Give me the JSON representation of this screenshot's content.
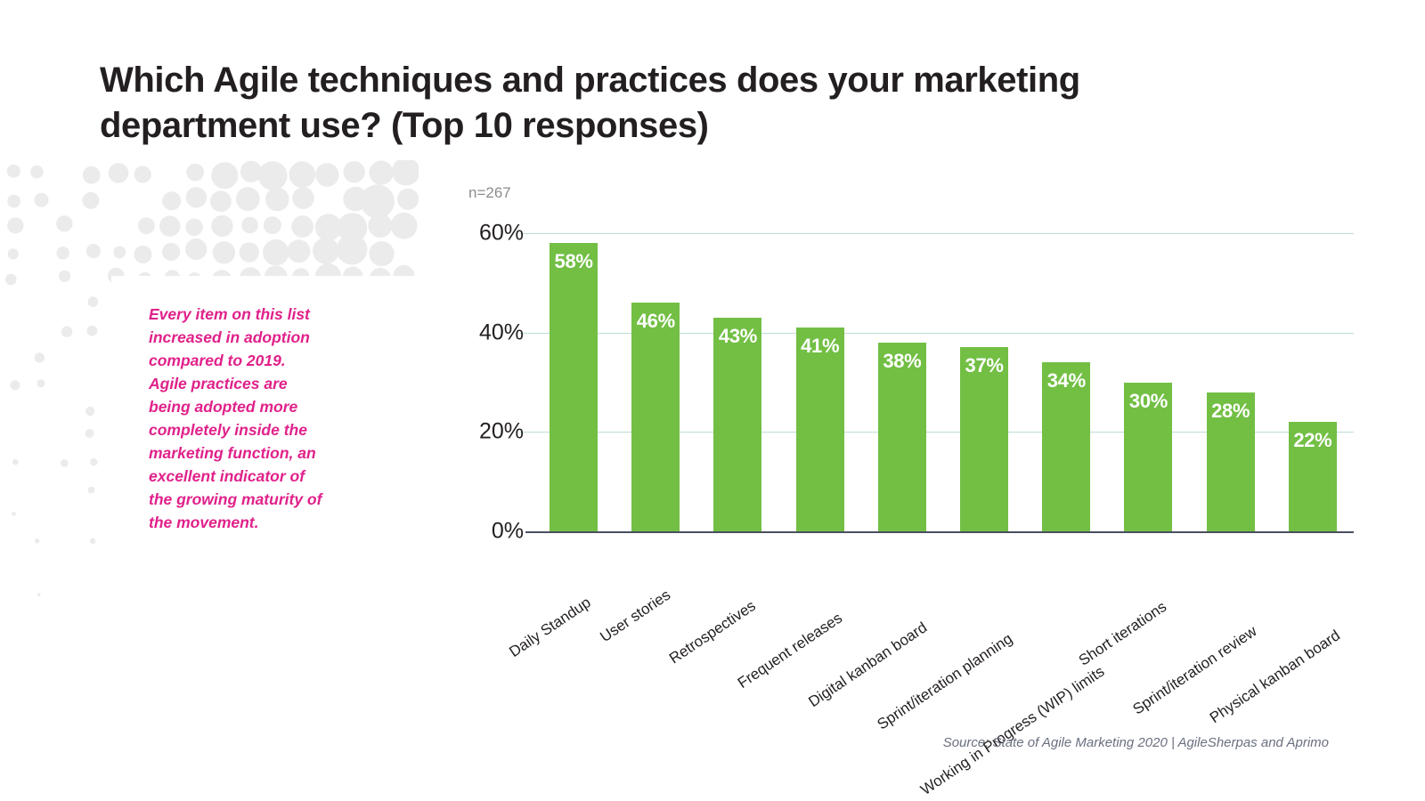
{
  "page_title": "Which Agile techniques and practices does your marketing department use? (Top 10 responses)",
  "callout_text": "Every item on this list increased in adoption compared to 2019. Agile practices are being adopted more completely inside the marketing function, an excellent indicator of the growing maturity of the movement.",
  "sample_size": "n=267",
  "source_note": "Source: State of Agile Marketing 2020 | AgileSherpas and Aprimo",
  "colors": {
    "bar_green": "#72bf44",
    "callout_pink": "#e0218a",
    "gridline": "#bcdcd9",
    "axis": "#4a4f5e",
    "title": "#231f20",
    "muted_gray": "#8c8c8c",
    "dot_gray": "#ebebeb"
  },
  "chart_data": {
    "type": "bar",
    "title": "Which Agile techniques and practices does your marketing department use? (Top 10 responses)",
    "xlabel": "",
    "ylabel": "",
    "ylim": [
      0,
      60
    ],
    "grid": true,
    "legend": "none",
    "orientation": "vertical",
    "value_suffix": "%",
    "ytick_labels": [
      "0%",
      "20%",
      "40%",
      "60%"
    ],
    "ytick_values": [
      0,
      20,
      40,
      60
    ],
    "categories": [
      "Daily Standup",
      "User stories",
      "Retrospectives",
      "Frequent releases",
      "Digital kanban board",
      "Sprint/iteration planning",
      "Working in Progress (WIP) limits",
      "Short iterations",
      "Sprint/iteration review",
      "Physical kanban board"
    ],
    "values": [
      58,
      46,
      43,
      41,
      38,
      37,
      34,
      30,
      28,
      22
    ],
    "data_labels": [
      "58%",
      "46%",
      "43%",
      "41%",
      "38%",
      "37%",
      "34%",
      "30%",
      "28%",
      "22%"
    ],
    "annotations": [
      "n=267"
    ]
  }
}
